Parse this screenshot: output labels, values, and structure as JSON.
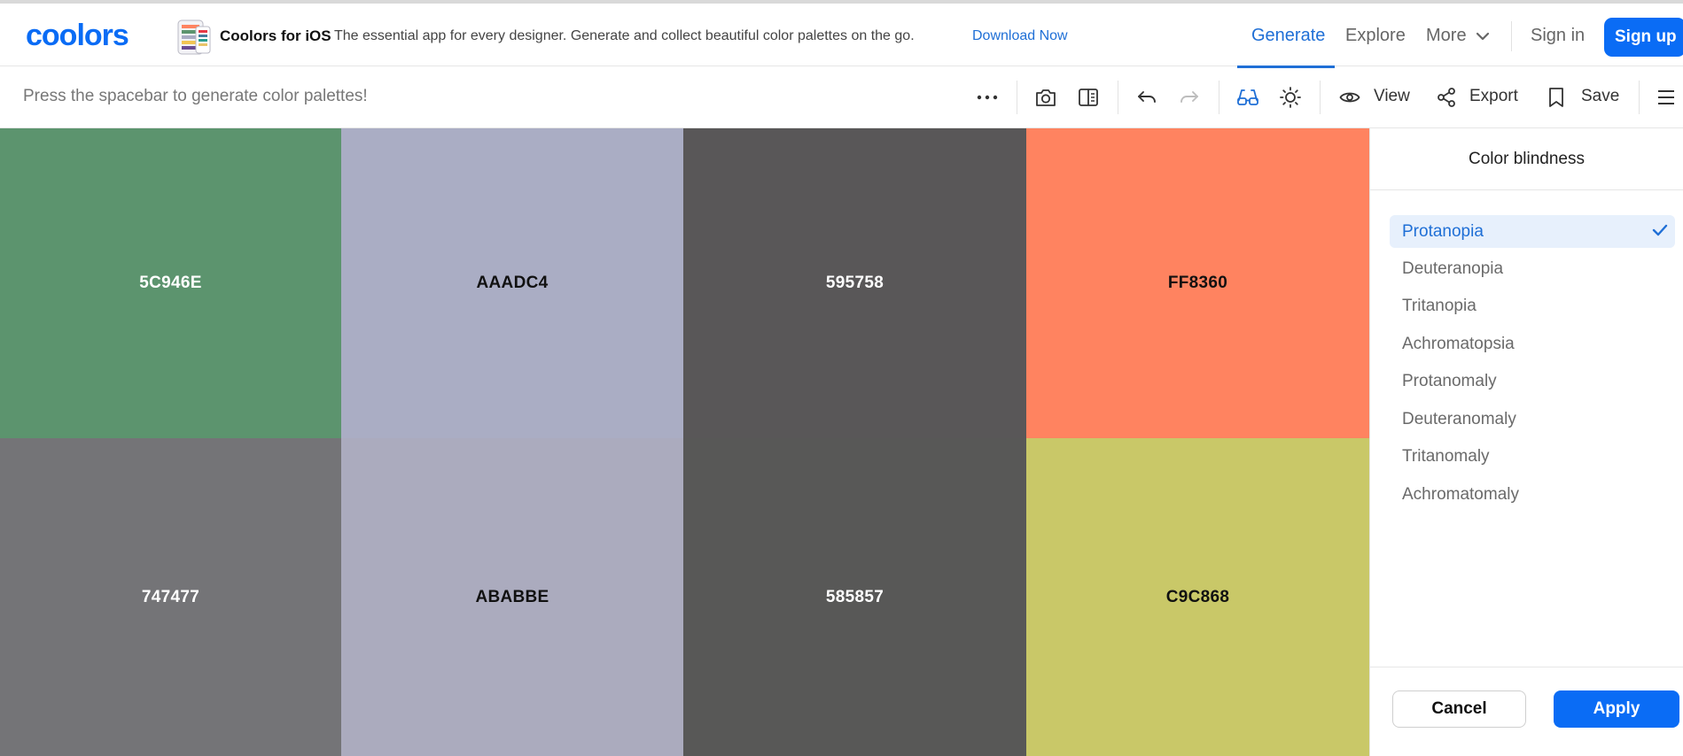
{
  "brand": {
    "logo_text": "coolors",
    "accent": "#0a6cf5"
  },
  "promo": {
    "title": "Coolors for iOS",
    "text": "The essential app for every designer. Generate and collect beautiful color palettes on the go.",
    "link": "Download Now"
  },
  "nav": {
    "generate": "Generate",
    "explore": "Explore",
    "more": "More",
    "signin": "Sign in",
    "signup": "Sign up"
  },
  "toolbar": {
    "hint": "Press the spacebar to generate color palettes!",
    "view": "View",
    "export": "Export",
    "save": "Save"
  },
  "palette": {
    "top": [
      {
        "hex": "5C946E",
        "color": "#5C946E",
        "text_color": "#ffffff"
      },
      {
        "hex": "AAADC4",
        "color": "#AAADC4",
        "text_color": "#111111"
      },
      {
        "hex": "595758",
        "color": "#595758",
        "text_color": "#ffffff"
      },
      {
        "hex": "FF8360",
        "color": "#FF8360",
        "text_color": "#111111"
      }
    ],
    "bottom": [
      {
        "hex": "747477",
        "color": "#747477",
        "text_color": "#ffffff"
      },
      {
        "hex": "ABABBE",
        "color": "#ABABBE",
        "text_color": "#111111"
      },
      {
        "hex": "585857",
        "color": "#585857",
        "text_color": "#ffffff"
      },
      {
        "hex": "C9C868",
        "color": "#C9C868",
        "text_color": "#111111"
      }
    ]
  },
  "panel": {
    "title": "Color blindness",
    "options": [
      {
        "label": "Protanopia",
        "selected": true
      },
      {
        "label": "Deuteranopia",
        "selected": false
      },
      {
        "label": "Tritanopia",
        "selected": false
      },
      {
        "label": "Achromatopsia",
        "selected": false
      },
      {
        "label": "Protanomaly",
        "selected": false
      },
      {
        "label": "Deuteranomaly",
        "selected": false
      },
      {
        "label": "Tritanomaly",
        "selected": false
      },
      {
        "label": "Achromatomaly",
        "selected": false
      }
    ],
    "cancel": "Cancel",
    "apply": "Apply"
  }
}
